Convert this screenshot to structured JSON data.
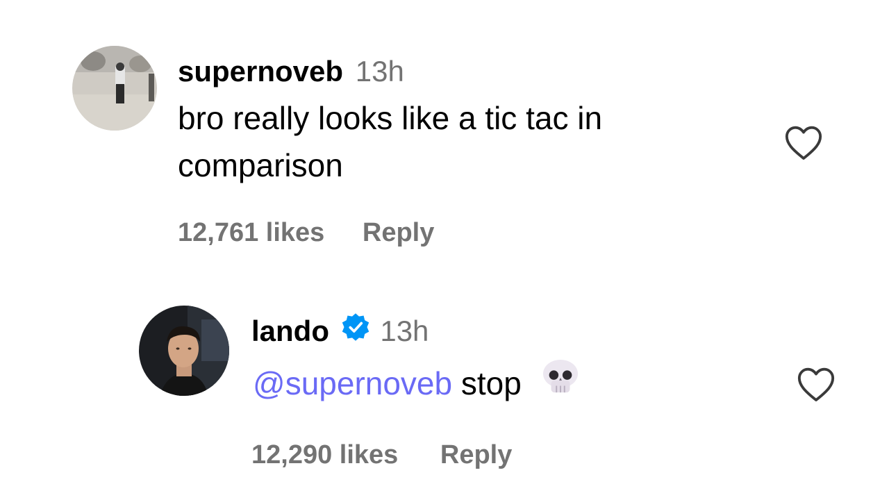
{
  "comments": [
    {
      "username": "supernoveb",
      "time": "13h",
      "text": "bro really looks like a tic tac in comparison",
      "text_line1": "bro really looks like a tic tac in",
      "text_line2": "comparison",
      "likes": "12,761 likes",
      "reply_label": "Reply",
      "verified": false
    },
    {
      "username": "lando",
      "time": "13h",
      "mention": "@supernoveb",
      "text": "stop",
      "emoji": "skull-emoji",
      "likes": "12,290 likes",
      "reply_label": "Reply",
      "verified": true
    }
  ],
  "icons": {
    "like": "heart-outline-icon",
    "verified": "verified-badge-icon"
  },
  "colors": {
    "mention": "#6a6af5",
    "secondary_text": "#737373",
    "verified_blue": "#0095f6"
  }
}
